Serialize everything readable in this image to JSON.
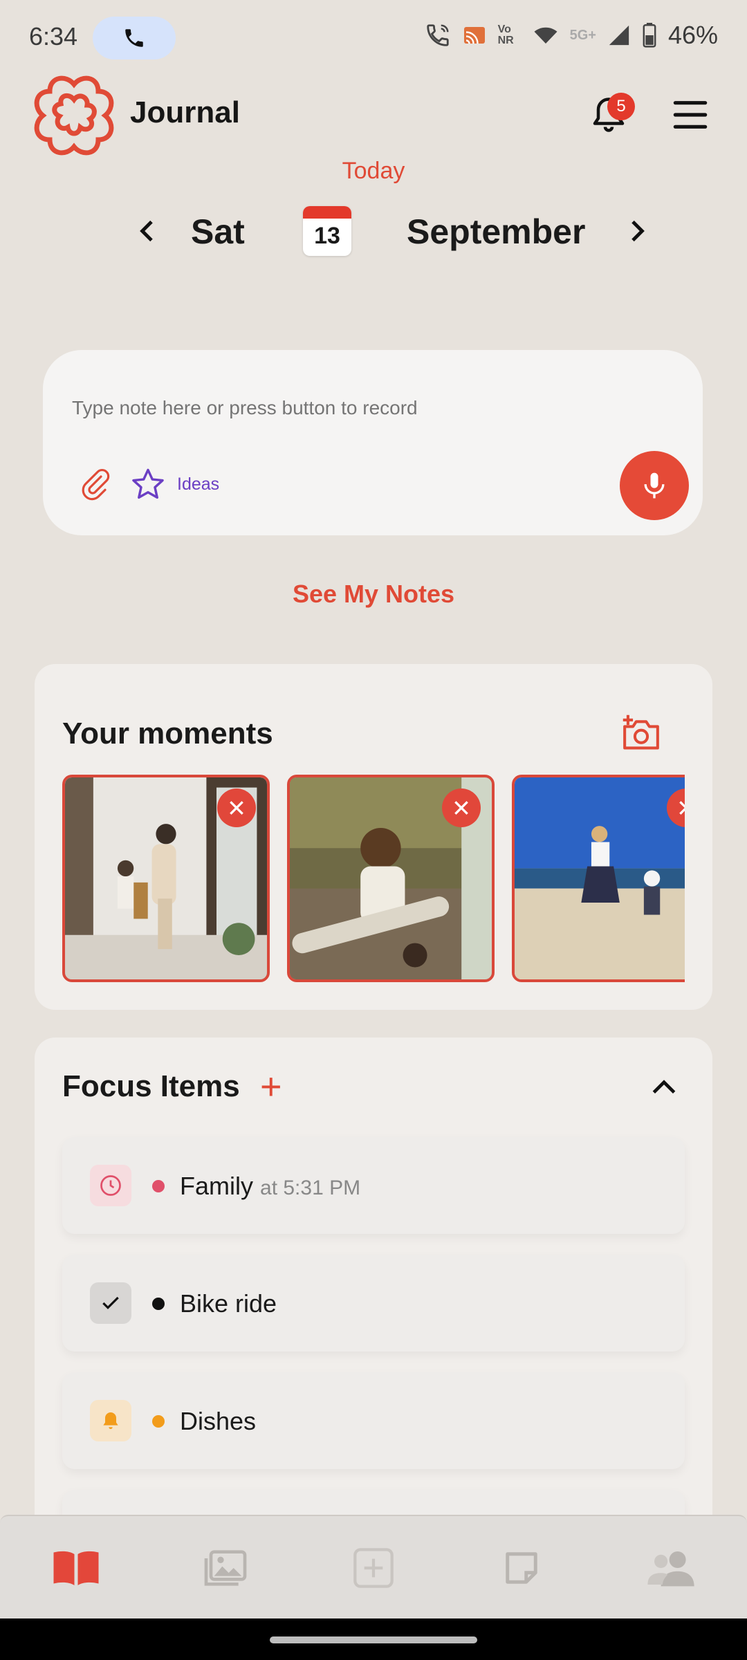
{
  "status_bar": {
    "time": "6:34",
    "battery": "46%",
    "network_5g": "5G+",
    "volte": "Vo NR",
    "icons": [
      "phone-icon",
      "wifi-calling-icon",
      "cast-icon",
      "volte-icon",
      "wifi-icon",
      "signal-icon",
      "battery-icon"
    ]
  },
  "header": {
    "title": "Journal",
    "notification_count": "5",
    "icons": [
      "logo-icon",
      "bell-icon",
      "menu-icon"
    ]
  },
  "date": {
    "today_label": "Today",
    "day": "Sat",
    "day_number": "13",
    "month": "September"
  },
  "note": {
    "placeholder": "Type note here or press button to record",
    "ideas_label": "Ideas",
    "see_notes_label": "See My Notes"
  },
  "moments": {
    "title": "Your moments",
    "photos": [
      {
        "name": "photo-family-dance"
      },
      {
        "name": "photo-child-log"
      },
      {
        "name": "photo-beach-walk"
      }
    ]
  },
  "focus": {
    "title": "Focus Items",
    "add_symbol": "+",
    "items": [
      {
        "label": "Family",
        "time": "at 5:31 PM",
        "dot_color": "#e0506a",
        "icon": "clock-icon"
      },
      {
        "label": "Bike ride",
        "time": "",
        "dot_color": "#111111",
        "icon": "check-icon"
      },
      {
        "label": "Dishes",
        "time": "",
        "dot_color": "#f29c1b",
        "icon": "bell-icon"
      }
    ]
  },
  "bottom_nav": {
    "items": [
      "journal-icon",
      "gallery-icon",
      "add-icon",
      "notes-icon",
      "community-icon"
    ],
    "active_color": "#e3473a"
  },
  "colors": {
    "accent": "#e04a36",
    "background": "#e7e2dc",
    "ideas": "#6b3fc4"
  }
}
